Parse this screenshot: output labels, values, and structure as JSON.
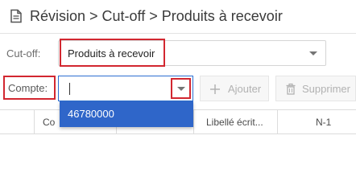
{
  "header": {
    "breadcrumb": "Révision > Cut-off > Produits à recevoir",
    "icon": "document-icon"
  },
  "cutoff": {
    "label": "Cut-off:",
    "selected_value": "Produits à recevoir"
  },
  "compte": {
    "label": "Compte:",
    "input_value": "",
    "dropdown_options": [
      "46780000"
    ]
  },
  "toolbar": {
    "add_label": "Ajouter",
    "delete_label": "Supprimer"
  },
  "table": {
    "columns": [
      "Co",
      "",
      "Libellé écrit...",
      "N-1"
    ]
  },
  "colors": {
    "highlight": "#d22730",
    "accent": "#2f66c9"
  }
}
